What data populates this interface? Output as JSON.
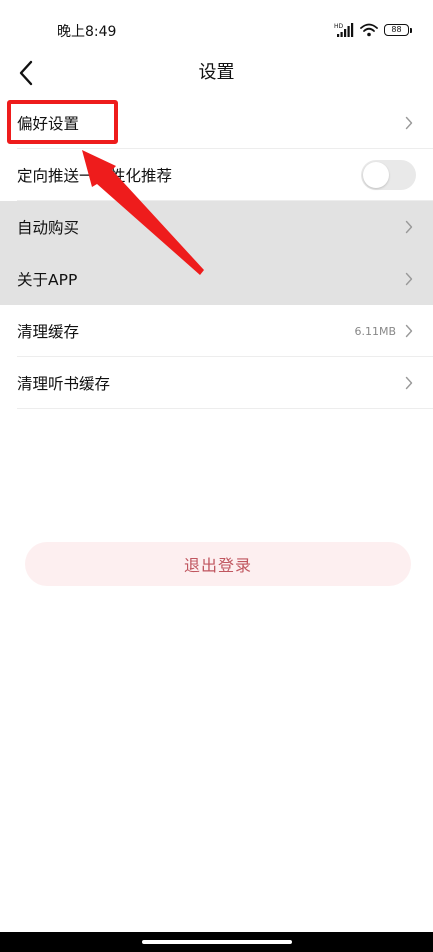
{
  "status_bar": {
    "time": "晚上8:49",
    "signal_label": "HD",
    "battery_level": "88"
  },
  "header": {
    "title": "设置",
    "back_icon": "chevron-left-icon"
  },
  "settings": {
    "items": [
      {
        "label": "偏好设置",
        "type": "link"
      },
      {
        "label": "定向推送一个性化推荐",
        "type": "toggle",
        "enabled": false
      },
      {
        "label": "自动购买",
        "type": "link"
      },
      {
        "label": "关于APP",
        "type": "link"
      },
      {
        "label": "清理缓存",
        "type": "link",
        "value": "6.11MB"
      },
      {
        "label": "清理听书缓存",
        "type": "link"
      }
    ]
  },
  "logout": {
    "label": "退出登录"
  },
  "colors": {
    "annotation": "#ee1c1c",
    "logout_bg": "#fdeff0",
    "logout_text": "#c0565f",
    "highlight_row": "#e2e2e2"
  }
}
